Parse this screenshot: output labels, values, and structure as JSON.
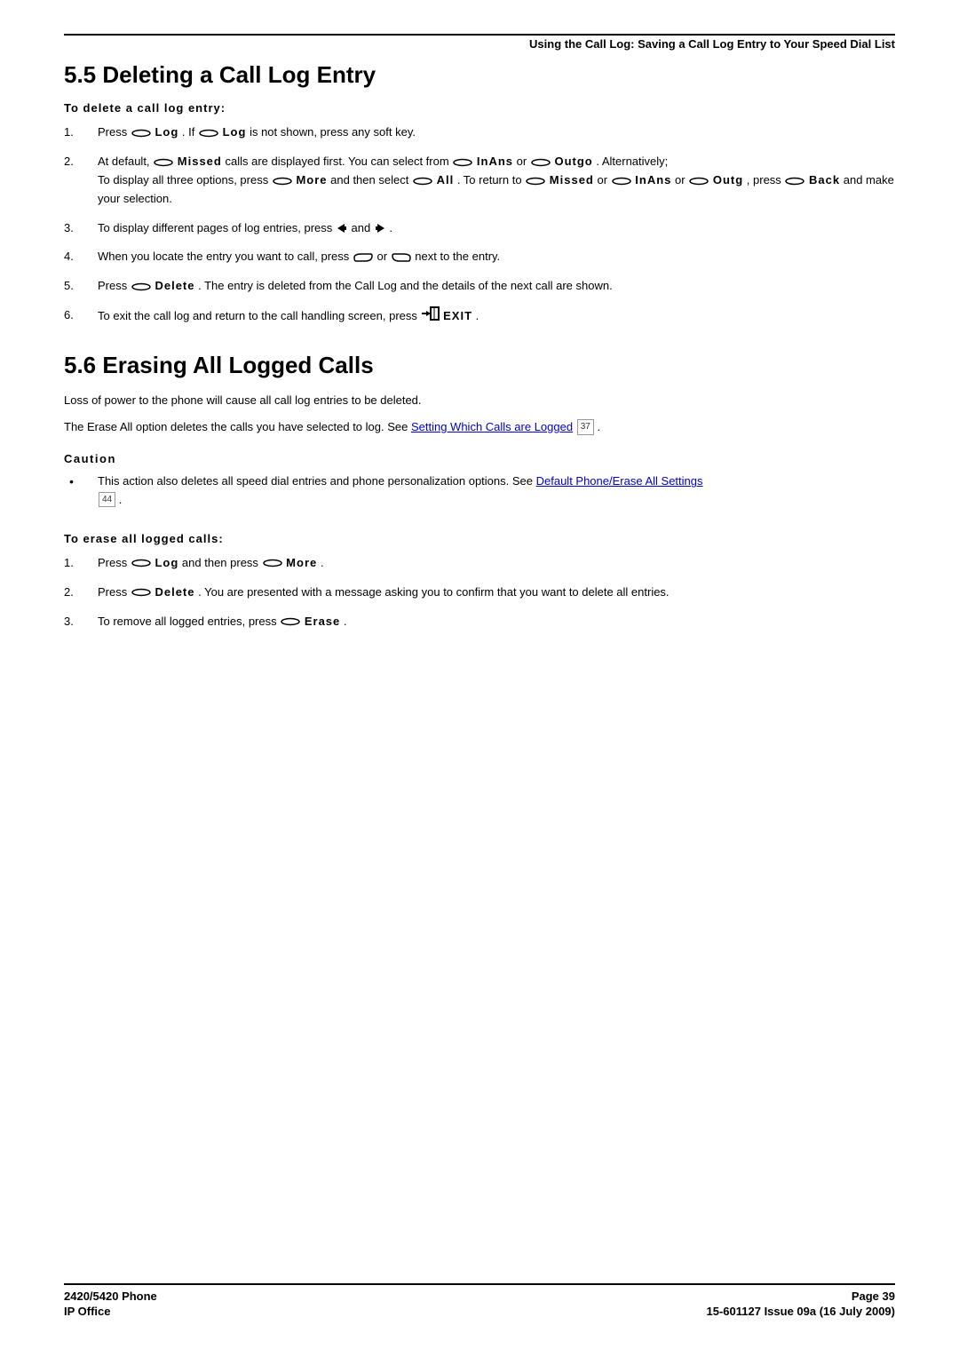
{
  "header": {
    "breadcrumb": "Using the Call Log: Saving a Call Log Entry to Your Speed Dial List"
  },
  "section55": {
    "heading": "5.5 Deleting a Call Log Entry",
    "intro": "To delete a call log entry:",
    "step1": {
      "pre": "Press ",
      "label1": " Log",
      "mid": ". If ",
      "label2": " Log",
      "post": " is not shown, press any soft key."
    },
    "step2": {
      "l1a": "At default, ",
      "l1b": " Missed",
      "l1c": " calls are displayed first. You can select from ",
      "l1d": " InAns",
      "l1e": " or ",
      "l1f": " Outgo",
      "l1g": ". Alternatively;",
      "l2a": "To display all three options, press ",
      "l2b": " More",
      "l2c": " and then select ",
      "l2d": " All",
      "l2e": ". To return to ",
      "l2f": " Missed",
      "l2g": " or ",
      "l2h": " InAns",
      "l2i": " or ",
      "l2j": " Outg",
      "l2k": ", press ",
      "l2l": " Back",
      "l2m": " and make your selection."
    },
    "step3": {
      "pre": "To display different pages of log entries, press ",
      "mid": " and ",
      "post": "."
    },
    "step4": {
      "pre": "When you locate the entry you want to call, press ",
      "mid": " or ",
      "post": " next to the entry."
    },
    "step5": {
      "pre": "Press ",
      "label": " Delete",
      "post": ". The entry is deleted from the Call Log and the details of the next call are shown."
    },
    "step6": {
      "pre": "To exit the call log and return to the call handling screen, press ",
      "label": " EXIT",
      "post": "."
    }
  },
  "section56": {
    "heading": "5.6 Erasing All Logged Calls",
    "p1": "Loss of power to the phone will cause all call log entries to be deleted.",
    "p2a": "The Erase All option deletes the calls you have selected to log. See ",
    "p2link": "Setting Which Calls are Logged",
    "p2ref": "37",
    "p2b": ".",
    "caution_label": "Caution",
    "caution_text_a": "This action also deletes all speed dial entries and phone personalization options. See ",
    "caution_link": "Default Phone/Erase All Settings",
    "caution_ref": "44",
    "caution_text_b": ".",
    "erase_intro": "To erase all logged calls:",
    "estep1": {
      "pre": "Press ",
      "label1": " Log",
      "mid": " and then press ",
      "label2": " More",
      "post": "."
    },
    "estep2": {
      "pre": "Press ",
      "label": " Delete",
      "post": ". You are presented with a message asking you to confirm that you want to delete all entries."
    },
    "estep3": {
      "pre": "To remove all logged entries, press ",
      "label": " Erase",
      "post": "."
    }
  },
  "footer": {
    "left1": "2420/5420 Phone",
    "left2": "IP Office",
    "right1": "Page 39",
    "right2": "15-601127 Issue 09a (16 July 2009)"
  }
}
